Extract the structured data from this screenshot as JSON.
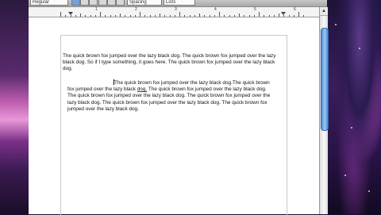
{
  "toolbar": {
    "style_field": "Regular",
    "spacing_field": "Spacing",
    "lists_field": "Lists"
  },
  "ruler": {
    "numbers": [
      "1",
      "2",
      "3",
      "4",
      "5",
      "6"
    ]
  },
  "scrollbar": {
    "up_arrow": "▲"
  },
  "document": {
    "paragraph1": "The quick brown fox jumped over the lazy black dog. The quick brown fox jumped over the lazy black dog. So if I type something, it goes here. The quick brown fox jumped over the lazy black dog.",
    "paragraph2_a": "The quick brown fox jumped over the lazy black dog.The quick brown fox jumped over the lazy black ",
    "paragraph2_underlined": "dog.",
    "paragraph2_b": " The quick brown fox jumped over the lazy black dog. The quick brown fox jumped over the lazy black dog. The quick brown fox jumped over the lazy black dog. The quick brown fox jumped over the lazy black dog. The quick brown fox jumped over the lazy black dog."
  }
}
